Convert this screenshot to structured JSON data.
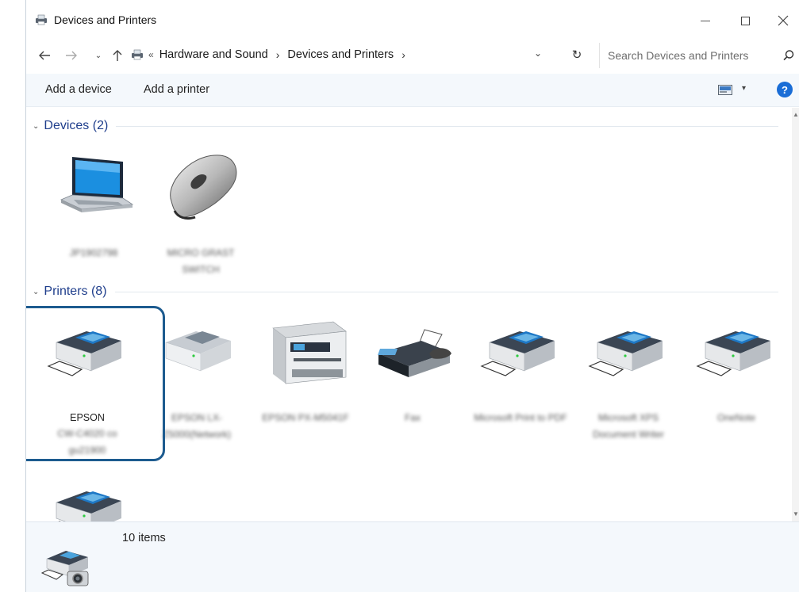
{
  "window": {
    "title": "Devices and Printers"
  },
  "nav": {
    "breadcrumb": [
      "Hardware and Sound",
      "Devices and Printers"
    ],
    "overflow": "«",
    "search_placeholder": "Search Devices and Printers"
  },
  "toolbar": {
    "add_device": "Add a device",
    "add_printer": "Add a printer"
  },
  "groups": {
    "devices": {
      "label": "Devices (2)"
    },
    "printers": {
      "label": "Printers (8)"
    }
  },
  "devices": [
    {
      "icon": "laptop-icon",
      "label": "JP1902798"
    },
    {
      "icon": "mouse-icon",
      "label": "MICRO GRAST SWITCH"
    }
  ],
  "printers": [
    {
      "icon": "printer-icon",
      "label": "EPSON",
      "sublabel": "CW-C4020 co gu21900"
    },
    {
      "icon": "printer-icon",
      "label": "EPSON LX-Z5000(Network)",
      "sublabel": ""
    },
    {
      "icon": "multifunction-printer-icon",
      "label": "EPSON PX-M5041F",
      "sublabel": ""
    },
    {
      "icon": "fax-icon",
      "label": "Fax",
      "sublabel": ""
    },
    {
      "icon": "printer-icon",
      "label": "Microsoft Print to PDF",
      "sublabel": ""
    },
    {
      "icon": "printer-icon",
      "label": "Microsoft XPS Document Writer",
      "sublabel": ""
    },
    {
      "icon": "printer-icon",
      "label": "OneNote",
      "sublabel": ""
    }
  ],
  "status": {
    "count": "10 items"
  },
  "colors": {
    "accent": "#1f3e8c",
    "highlight": "#1d5b8f",
    "bar_bg": "#f4f8fc"
  }
}
